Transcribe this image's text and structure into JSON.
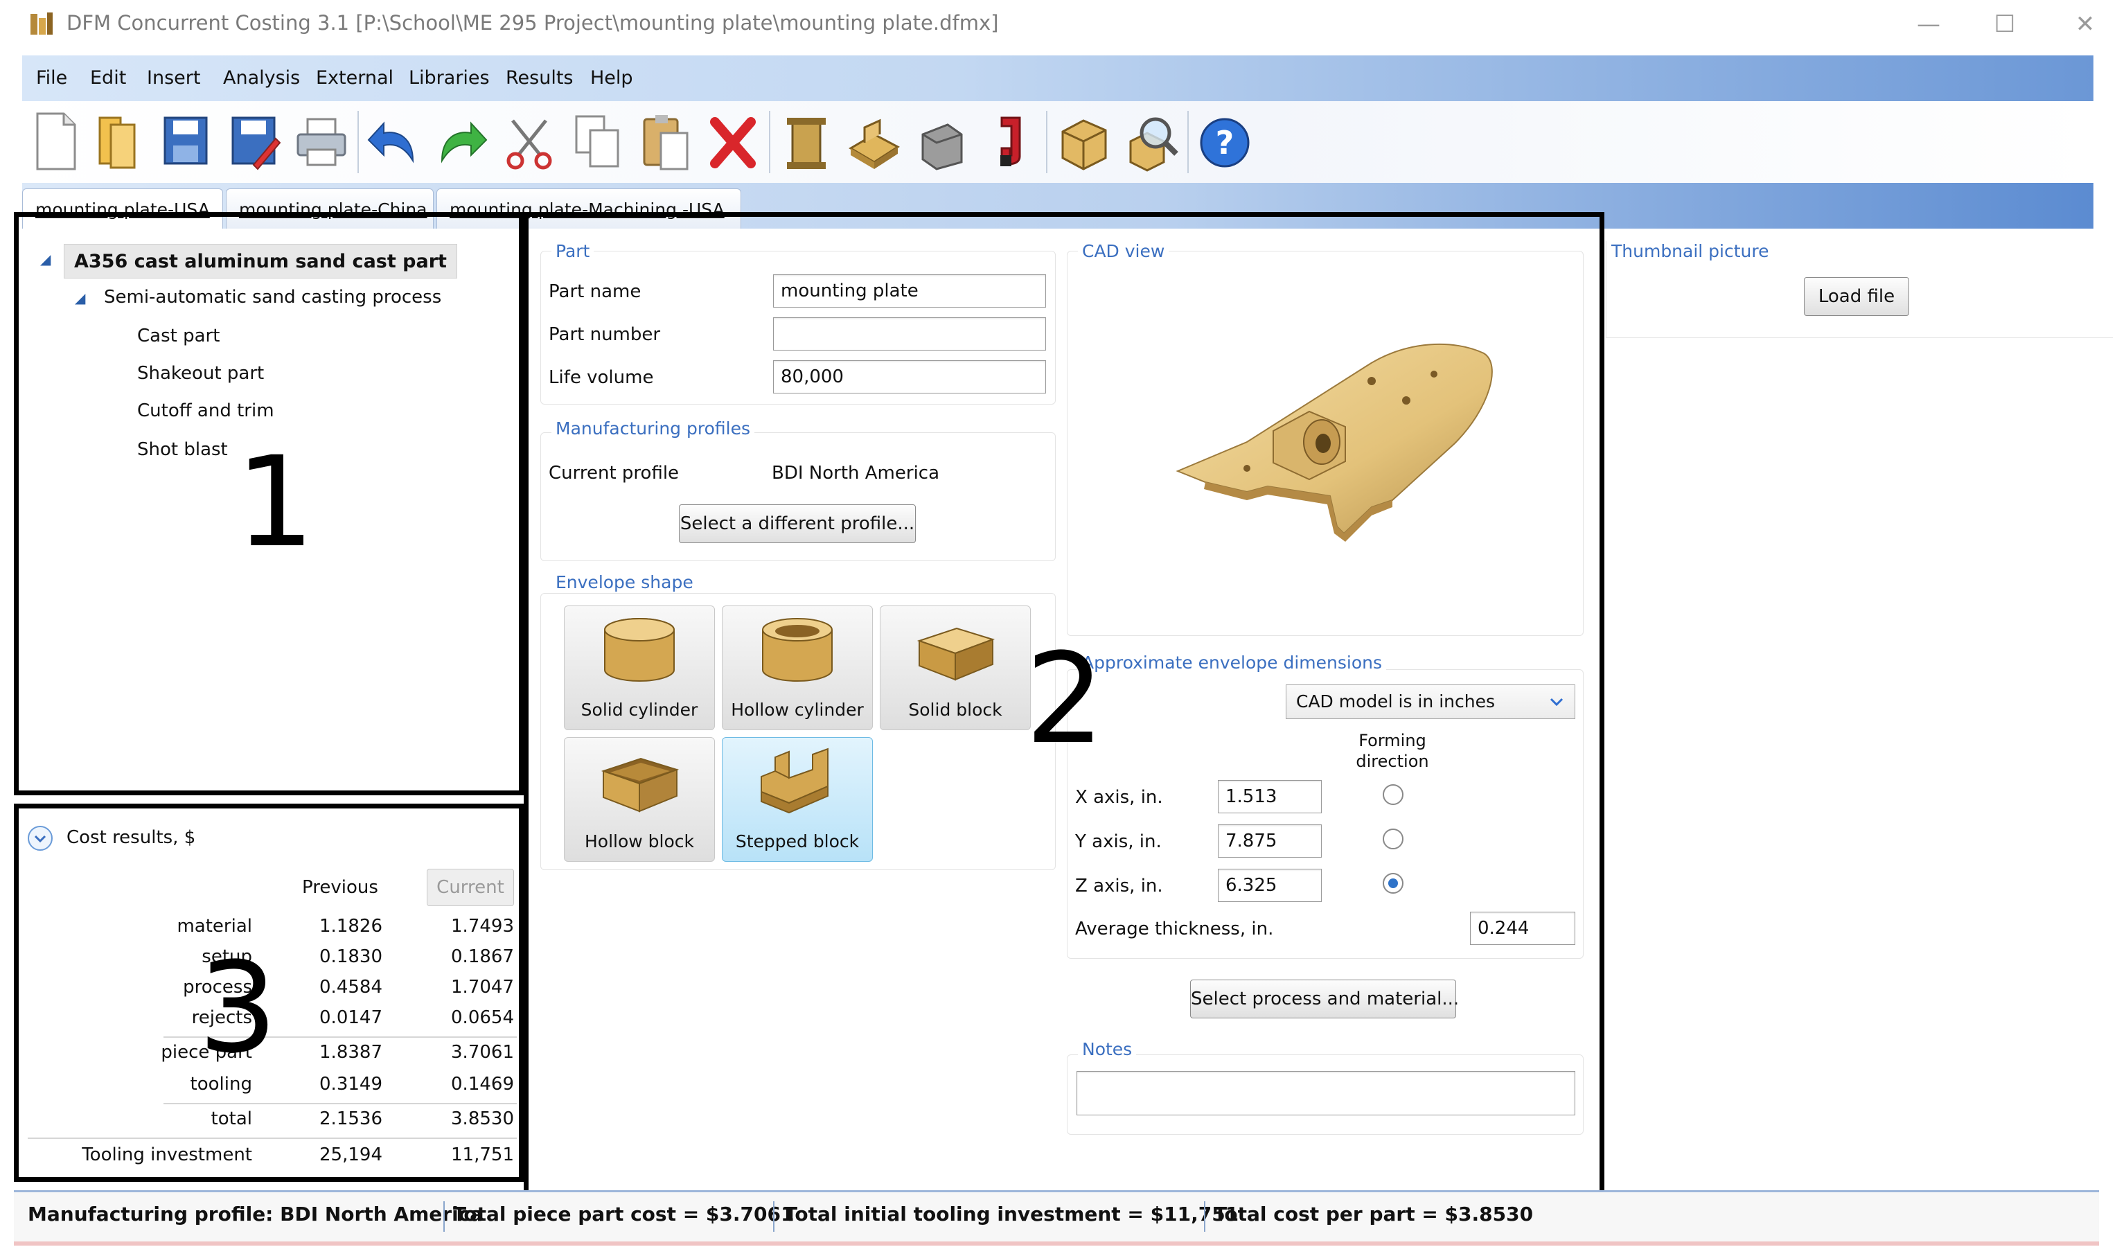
{
  "window": {
    "title": "DFM Concurrent Costing 3.1 [P:\\School\\ME 295 Project\\mounting plate\\mounting plate.dfmx]",
    "minimize": "—",
    "maximize": "☐",
    "close": "✕"
  },
  "menu": [
    "File",
    "Edit",
    "Insert",
    "Analysis",
    "External",
    "Libraries",
    "Results",
    "Help"
  ],
  "toolbar": [
    "new-icon",
    "open-icon",
    "save-icon",
    "save-as-icon",
    "print-icon",
    "undo-icon",
    "redo-icon",
    "cut-icon",
    "copy-icon",
    "paste-icon",
    "delete-icon",
    "process-icon",
    "material-icon",
    "operation-icon",
    "magnet-icon",
    "part-icon",
    "analysis-zoom-icon",
    "help-icon"
  ],
  "tabs": [
    "mounting plate-USA",
    "mounting plate-China",
    "mounting plate-Machining -USA"
  ],
  "tree": {
    "root": "A356 cast aluminum sand cast part",
    "process": "Semi-automatic sand casting process",
    "operations": [
      "Cast part",
      "Shakeout part",
      "Cutoff and trim",
      "Shot blast"
    ]
  },
  "annotations": [
    "1",
    "2",
    "3"
  ],
  "cost": {
    "header": "Cost results, $",
    "col_previous": "Previous",
    "col_current": "Current",
    "rows": [
      {
        "label": "material",
        "previous": "1.1826",
        "current": "1.7493"
      },
      {
        "label": "setup",
        "previous": "0.1830",
        "current": "0.1867"
      },
      {
        "label": "process",
        "previous": "0.4584",
        "current": "1.7047"
      },
      {
        "label": "rejects",
        "previous": "0.0147",
        "current": "0.0654"
      },
      {
        "label": "piece part",
        "previous": "1.8387",
        "current": "3.7061"
      },
      {
        "label": "tooling",
        "previous": "0.3149",
        "current": "0.1469"
      },
      {
        "label": "total",
        "previous": "2.1536",
        "current": "3.8530"
      },
      {
        "label": "Tooling investment",
        "previous": "25,194",
        "current": "11,751"
      }
    ]
  },
  "part": {
    "group": "Part",
    "name_label": "Part name",
    "name_value": "mounting plate",
    "number_label": "Part number",
    "number_value": "",
    "volume_label": "Life volume",
    "volume_value": "80,000"
  },
  "profiles": {
    "group": "Manufacturing profiles",
    "current_label": "Current profile",
    "current_value": "BDI North America",
    "button": "Select a different profile..."
  },
  "envelope": {
    "group": "Envelope shape",
    "shapes": [
      "Solid cylinder",
      "Hollow cylinder",
      "Solid block",
      "Hollow block",
      "Stepped block"
    ],
    "selected": "Stepped block"
  },
  "cad": {
    "group": "CAD view"
  },
  "thumbnail": {
    "group": "Thumbnail picture",
    "button": "Load file"
  },
  "dimensions": {
    "group": "Approximate envelope dimensions",
    "unit_select": "CAD model is in inches",
    "forming_label": "Forming\ndirection",
    "x_label": "X axis, in.",
    "x_value": "1.513",
    "y_label": "Y axis, in.",
    "y_value": "7.875",
    "z_label": "Z axis, in.",
    "z_value": "6.325",
    "forming_selected": "Z",
    "thickness_label": "Average thickness, in.",
    "thickness_value": "0.244"
  },
  "process_button": "Select process and material...",
  "notes": {
    "group": "Notes",
    "value": ""
  },
  "status": [
    "Manufacturing profile: BDI North America",
    "Total piece part cost = $3.7061",
    "Total initial tooling investment = $11,751",
    "Total cost per part = $3.8530"
  ],
  "colors": {
    "accent": "#3b6fc0",
    "selected_shape": "#b8e2f8",
    "part_gold": "#e3c27a"
  }
}
